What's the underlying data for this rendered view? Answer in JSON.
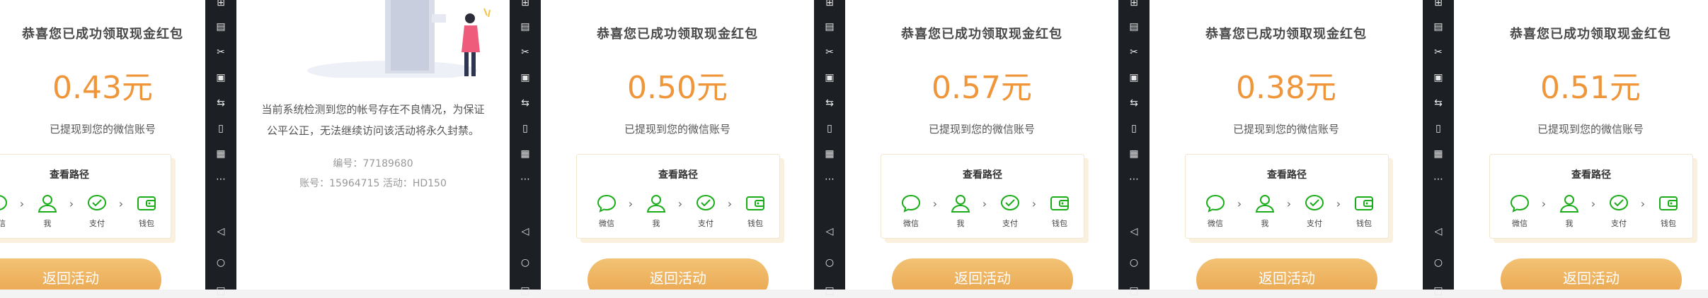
{
  "reward_panels": [
    {
      "title": "恭喜您已成功领取现金红包",
      "amount": "0.43元",
      "note": "已提现到您的微信账号",
      "path_title": "查看路径",
      "steps": [
        "微信",
        "我",
        "支付",
        "钱包"
      ],
      "button": "返回活动"
    },
    {
      "title": "恭喜您已成功领取现金红包",
      "amount": "0.50元",
      "note": "已提现到您的微信账号",
      "path_title": "查看路径",
      "steps": [
        "微信",
        "我",
        "支付",
        "钱包"
      ],
      "button": "返回活动"
    },
    {
      "title": "恭喜您已成功领取现金红包",
      "amount": "0.57元",
      "note": "已提现到您的微信账号",
      "path_title": "查看路径",
      "steps": [
        "微信",
        "我",
        "支付",
        "钱包"
      ],
      "button": "返回活动"
    },
    {
      "title": "恭喜您已成功领取现金红包",
      "amount": "0.38元",
      "note": "已提现到您的微信账号",
      "path_title": "查看路径",
      "steps": [
        "微信",
        "我",
        "支付",
        "钱包"
      ],
      "button": "返回活动"
    },
    {
      "title": "恭喜您已成功领取现金红包",
      "amount": "0.51元",
      "note": "已提现到您的微信账号",
      "path_title": "查看路径",
      "steps": [
        "微信",
        "我",
        "支付",
        "钱包"
      ],
      "button": "返回活动"
    }
  ],
  "blocked_panel": {
    "message_line1": "当前系统检测到您的帐号存在不良情况，为保证",
    "message_line2": "公平公正，无法继续访问该活动将永久封禁。",
    "code_line": "编号：77189680",
    "account_line": "账号：15964715   活动：HD150"
  },
  "side_toolbar_icons": [
    "add-square-icon",
    "apk-icon",
    "scissors-icon",
    "video-icon",
    "swap-icon",
    "vibrate-icon",
    "qr-code-icon",
    "more-icon",
    "back-triangle-icon",
    "home-circle-icon",
    "recents-square-icon"
  ],
  "colors": {
    "accent": "#f0963a",
    "wechat_green": "#1aad19",
    "toolbar_bg": "#1c1f24"
  }
}
